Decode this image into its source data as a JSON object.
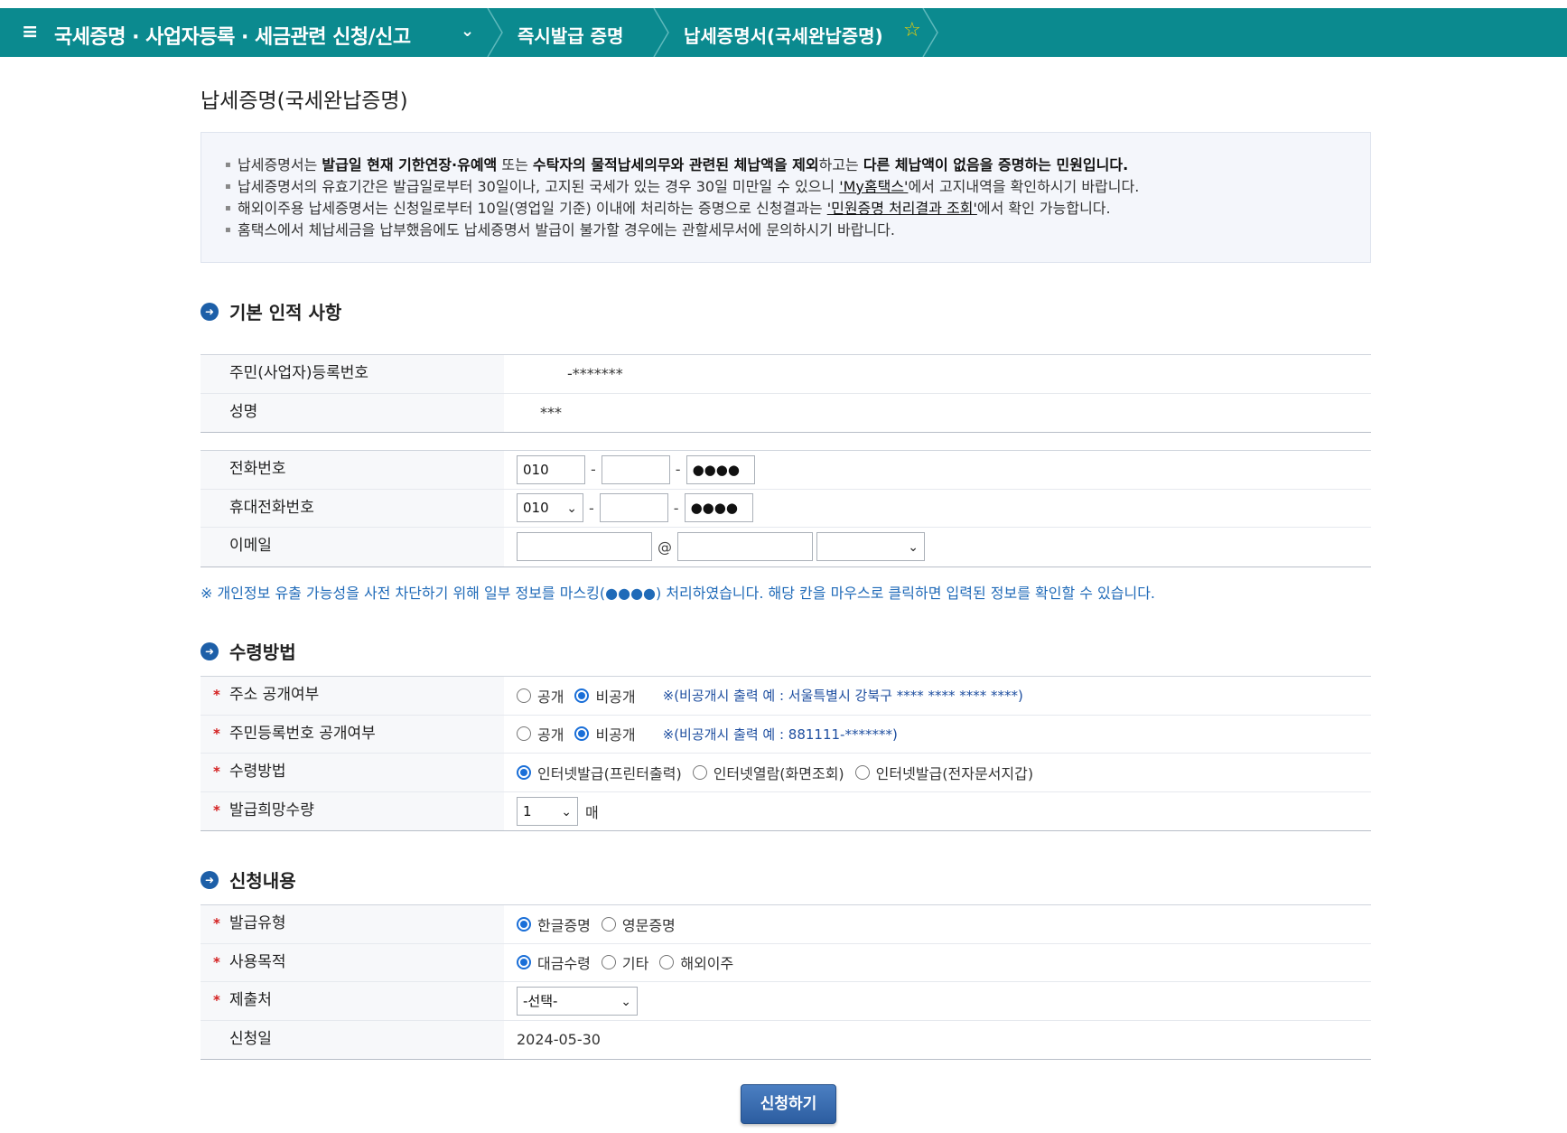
{
  "nav": {
    "main": "국세증명 · 사업자등록 · 세금관련 신청/신고",
    "sub1": "즉시발급 증명",
    "sub2": "납세증명서(국세완납증명)"
  },
  "page_title": "납세증명(국세완납증명)",
  "notice": {
    "items": [
      "납세증명서는 발급일 현재 기한연장·유예액 또는 수탁자의 물적납세의무와 관련된 체납액을 제외하고는 다른 체납액이 없음을 증명하는 민원입니다.",
      "납세증명서의 유효기간은 발급일로부터 30일이나, 고지된 국세가 있는 경우 30일 미만일 수 있으니 'My홈택스'에서 고지내역을 확인하시기 바랍니다.",
      "해외이주용 납세증명서는 신청일로부터 10일(영업일 기준) 이내에 처리하는 증명으로 신청결과는 '민원증명 처리결과 조회'에서 확인 가능합니다.",
      "홈택스에서 체납세금을 납부했음에도 납세증명서 발급이 불가할 경우에는 관할세무서에 문의하시기 바랍니다."
    ],
    "item1_parts": [
      "납세증명서는 ",
      "발급일 현재 기한연장·유예액",
      " 또는 ",
      "수탁자의 물적납세의무와 관련된 체납액을 제외",
      "하고는 ",
      "다른 체납액이 없음을 증명하는 민원입니다."
    ],
    "item2_parts": [
      "납세증명서의 유효기간은 발급일로부터 30일이나, 고지된 국세가 있는 경우 30일 미만일 수 있으니 ",
      "'My홈택스'",
      "에서 고지내역을 확인하시기 바랍니다."
    ],
    "item3_parts": [
      "해외이주용 납세증명서는 신청일로부터 10일(영업일 기준) 이내에 처리하는 증명으로 신청결과는 ",
      "'민원증명 처리결과 조회'",
      "에서 확인 가능합니다."
    ]
  },
  "section1": {
    "title": "기본 인적 사항",
    "rrn_label": "주민(사업자)등록번호",
    "rrn_value": "-*******",
    "name_label": "성명",
    "name_value": "***",
    "phone_label": "전화번호",
    "phone": [
      "010",
      "",
      "●●●●"
    ],
    "mobile_label": "휴대전화번호",
    "mobile": [
      "010",
      "",
      "●●●●"
    ],
    "email_label": "이메일",
    "email_at": "@",
    "dash": "-"
  },
  "privacy_note": "※ 개인정보 유출 가능성을 사전 차단하기 위해 일부 정보를 마스킹(●●●●) 처리하였습니다. 해당 칸을 마우스로 클릭하면 입력된 정보를 확인할 수 있습니다.",
  "section2": {
    "title": "수령방법",
    "req_mark": "*",
    "addr_label": "주소 공개여부",
    "rrn_pub_label": "주민등록번호 공개여부",
    "opt_public": "공개",
    "opt_private": "비공개",
    "addr_hint": "※(비공개시 출력 예 : 서울특별시 강북구 **** **** **** ****)",
    "rrn_hint": "※(비공개시 출력 예 : 881111-*******)",
    "method_label": "수령방법",
    "method_opts": [
      "인터넷발급(프린터출력)",
      "인터넷열람(화면조회)",
      "인터넷발급(전자문서지갑)"
    ],
    "qty_label": "발급희망수량",
    "qty_value": "1",
    "qty_unit": "매"
  },
  "section3": {
    "title": "신청내용",
    "type_label": "발급유형",
    "type_opts": [
      "한글증명",
      "영문증명"
    ],
    "purpose_label": "사용목적",
    "purpose_opts": [
      "대금수령",
      "기타",
      "해외이주"
    ],
    "submit_to_label": "제출처",
    "submit_to_value": "-선택-",
    "date_label": "신청일",
    "date_value": "2024-05-30"
  },
  "submit_button": "신청하기"
}
